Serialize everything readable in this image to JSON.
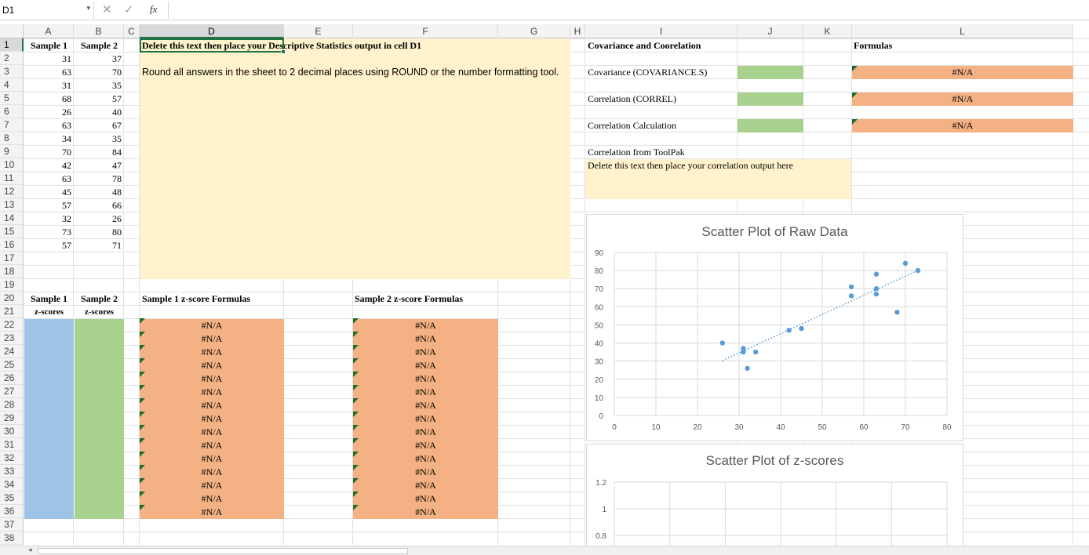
{
  "formula_bar": {
    "name_box": "D1",
    "fx": "fx",
    "formula": ""
  },
  "columns": [
    {
      "label": "A"
    },
    {
      "label": "B"
    },
    {
      "label": "C"
    },
    {
      "label": "D",
      "selected": true
    },
    {
      "label": "E"
    },
    {
      "label": "F"
    },
    {
      "label": "G"
    },
    {
      "label": "H"
    },
    {
      "label": "I"
    },
    {
      "label": "J"
    },
    {
      "label": "K"
    },
    {
      "label": "L"
    }
  ],
  "rows": [
    "1",
    "2",
    "3",
    "4",
    "5",
    "6",
    "7",
    "8",
    "9",
    "10",
    "11",
    "12",
    "13",
    "14",
    "15",
    "16",
    "17",
    "18",
    "19",
    "20",
    "21",
    "22",
    "23",
    "24",
    "25",
    "26",
    "27",
    "28",
    "29",
    "30",
    "31",
    "32",
    "33",
    "34",
    "35",
    "36",
    "37",
    "38"
  ],
  "data": {
    "header_a": "Sample 1",
    "header_b": "Sample 2",
    "sample1": [
      "31",
      "63",
      "31",
      "68",
      "26",
      "63",
      "34",
      "70",
      "42",
      "63",
      "45",
      "57",
      "32",
      "73",
      "57"
    ],
    "sample2": [
      "37",
      "70",
      "35",
      "57",
      "40",
      "67",
      "35",
      "84",
      "47",
      "78",
      "48",
      "66",
      "26",
      "80",
      "71"
    ]
  },
  "instructions": {
    "d1": "Delete this text then place your Descriptive Statistics output in cell D1",
    "d3": "Round all answers in the sheet to 2 decimal places using ROUND or the number formatting tool."
  },
  "zscores": {
    "a20": "Sample 1",
    "b20": "Sample 2",
    "a21": "z-scores",
    "b21": "z-scores",
    "d20": "Sample 1 z-score Formulas",
    "f20": "Sample 2 z-score Formulas",
    "d_values": [
      "#N/A",
      "#N/A",
      "#N/A",
      "#N/A",
      "#N/A",
      "#N/A",
      "#N/A",
      "#N/A",
      "#N/A",
      "#N/A",
      "#N/A",
      "#N/A",
      "#N/A",
      "#N/A",
      "#N/A"
    ],
    "f_values": [
      "#N/A",
      "#N/A",
      "#N/A",
      "#N/A",
      "#N/A",
      "#N/A",
      "#N/A",
      "#N/A",
      "#N/A",
      "#N/A",
      "#N/A",
      "#N/A",
      "#N/A",
      "#N/A",
      "#N/A"
    ]
  },
  "covariance": {
    "title": "Covariance and Coorelation",
    "formulas_title": "Formulas",
    "cov_label": "Covariance (COVARIANCE.S)",
    "corr_label": "Correlation (CORREL)",
    "calc_label": "Correlation Calculation",
    "cov_formula": "#N/A",
    "corr_formula": "#N/A",
    "calc_formula": "#N/A",
    "toolpak_label": "Correlation from ToolPak",
    "toolpak_placeholder": "Delete this text then place your correlation output here"
  },
  "colors": {
    "cream": "#fff2cc",
    "green": "#a9d18e",
    "orange": "#f4b183",
    "blue": "#9dc3e6",
    "marker": "#5b9bd5"
  },
  "chart_data": [
    {
      "type": "scatter",
      "title": "Scatter Plot of Raw Data",
      "xlim": [
        0,
        80
      ],
      "ylim": [
        0,
        90
      ],
      "xticks": [
        "0",
        "10",
        "20",
        "30",
        "40",
        "50",
        "60",
        "70",
        "80"
      ],
      "yticks": [
        "0",
        "10",
        "20",
        "30",
        "40",
        "50",
        "60",
        "70",
        "80",
        "90"
      ],
      "x": [
        31,
        63,
        31,
        68,
        26,
        63,
        34,
        70,
        42,
        63,
        45,
        57,
        32,
        73,
        57
      ],
      "y": [
        37,
        70,
        35,
        57,
        40,
        67,
        35,
        84,
        47,
        78,
        48,
        66,
        26,
        80,
        71
      ],
      "trendline": "linear-dotted",
      "grid": true
    },
    {
      "type": "scatter",
      "title": "Scatter Plot of z-scores",
      "yticks": [
        "1.2",
        "1",
        "0.8"
      ],
      "x": [],
      "y": [],
      "grid": true
    }
  ]
}
